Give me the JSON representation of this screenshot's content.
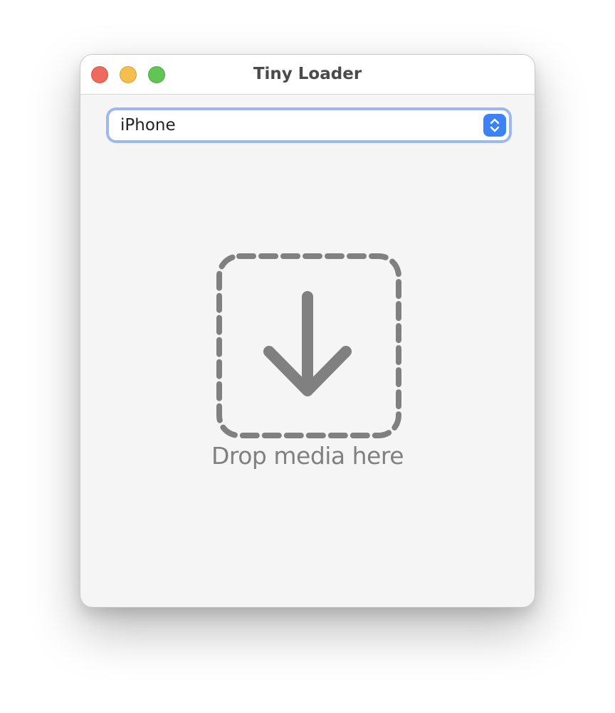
{
  "window": {
    "title": "Tiny Loader"
  },
  "device_select": {
    "selected": "iPhone",
    "icon": "chevron-up-down-icon"
  },
  "drop_zone": {
    "label": "Drop media here",
    "icon": "arrow-down-icon",
    "color": "#808080"
  },
  "colors": {
    "close": "#ee6a5e",
    "minimize": "#f5bf4f",
    "maximize": "#61c554",
    "accent": "#3b82f6"
  }
}
